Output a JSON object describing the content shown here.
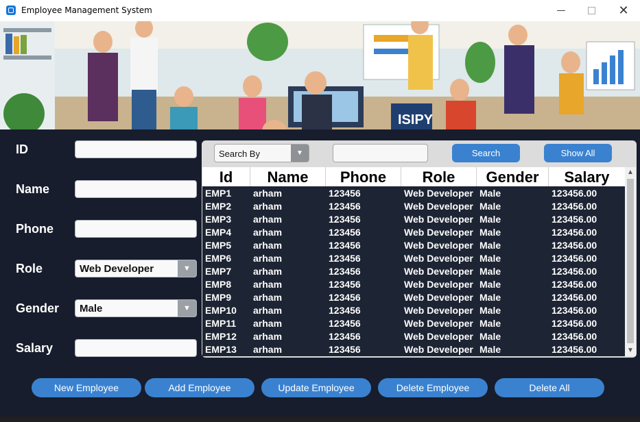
{
  "window": {
    "title": "Employee Management System",
    "minimize_glyph": "—",
    "close_glyph": "✕"
  },
  "form": {
    "id_label": "ID",
    "id_value": "",
    "name_label": "Name",
    "name_value": "",
    "phone_label": "Phone",
    "phone_value": "",
    "role_label": "Role",
    "role_value": "Web Developer",
    "gender_label": "Gender",
    "gender_value": "Male",
    "salary_label": "Salary",
    "salary_value": ""
  },
  "search": {
    "by_value": "Search By",
    "query": "",
    "search_label": "Search",
    "show_all_label": "Show All"
  },
  "table": {
    "columns": [
      "Id",
      "Name",
      "Phone",
      "Role",
      "Gender",
      "Salary"
    ],
    "rows": [
      [
        "EMP1",
        "arham",
        "123456",
        "Web Developer",
        "Male",
        "123456.00"
      ],
      [
        "EMP2",
        "arham",
        "123456",
        "Web Developer",
        "Male",
        "123456.00"
      ],
      [
        "EMP3",
        "arham",
        "123456",
        "Web Developer",
        "Male",
        "123456.00"
      ],
      [
        "EMP4",
        "arham",
        "123456",
        "Web Developer",
        "Male",
        "123456.00"
      ],
      [
        "EMP5",
        "arham",
        "123456",
        "Web Developer",
        "Male",
        "123456.00"
      ],
      [
        "EMP6",
        "arham",
        "123456",
        "Web Developer",
        "Male",
        "123456.00"
      ],
      [
        "EMP7",
        "arham",
        "123456",
        "Web Developer",
        "Male",
        "123456.00"
      ],
      [
        "EMP8",
        "arham",
        "123456",
        "Web Developer",
        "Male",
        "123456.00"
      ],
      [
        "EMP9",
        "arham",
        "123456",
        "Web Developer",
        "Male",
        "123456.00"
      ],
      [
        "EMP10",
        "arham",
        "123456",
        "Web Developer",
        "Male",
        "123456.00"
      ],
      [
        "EMP11",
        "arham",
        "123456",
        "Web Developer",
        "Male",
        "123456.00"
      ],
      [
        "EMP12",
        "arham",
        "123456",
        "Web Developer",
        "Male",
        "123456.00"
      ],
      [
        "EMP13",
        "arham",
        "123456",
        "Web Developer",
        "Male",
        "123456.00"
      ]
    ]
  },
  "actions": {
    "new_label": "New Employee",
    "add_label": "Add Employee",
    "update_label": "Update Employee",
    "delete_label": "Delete Employee",
    "delete_all_label": "Delete All"
  },
  "banner": {
    "sign_text": "ISIPY"
  },
  "colors": {
    "background": "#171d2c",
    "accent": "#3a82d0",
    "table_bg": "#1d2433"
  }
}
